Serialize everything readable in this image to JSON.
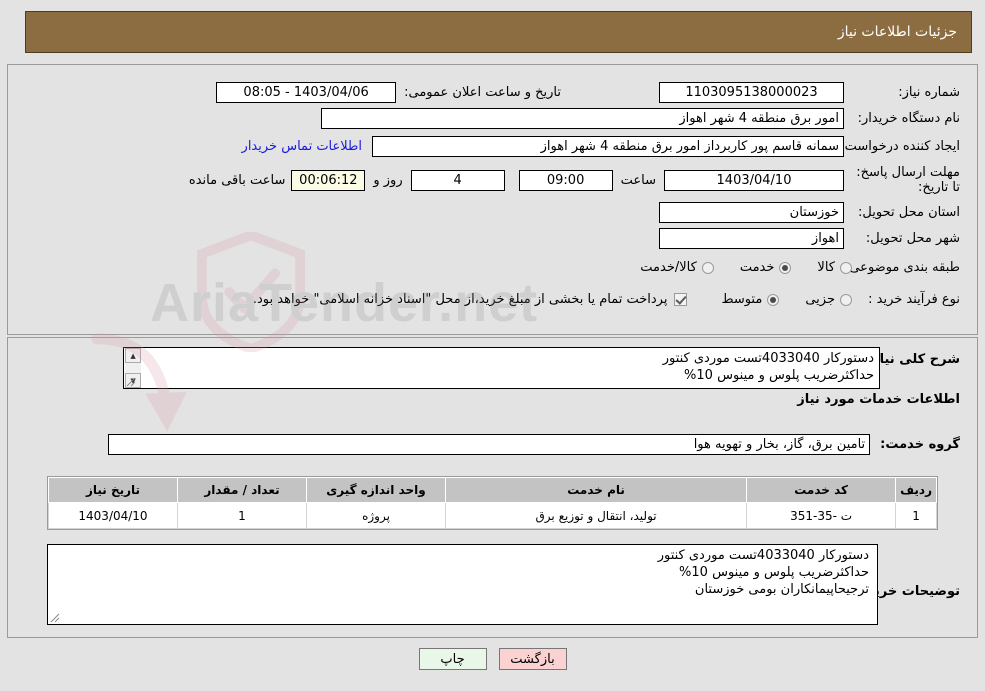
{
  "header": {
    "title": "جزئیات اطلاعات نیاز"
  },
  "top_form": {
    "need_number_label": "شماره نیاز:",
    "need_number_value": "1103095138000023",
    "public_announce_label": "تاریخ و ساعت اعلان عمومی:",
    "public_announce_value": "1403/04/06 - 08:05",
    "buyer_org_label": "نام دستگاه خریدار:",
    "buyer_org_value": "امور برق منطقه 4 شهر اهواز",
    "requester_label": "ایجاد کننده درخواست:",
    "requester_value": "سمانه قاسم پور کاربرداز امور برق منطقه 4 شهر اهواز",
    "buyer_contact_link": "اطلاعات تماس خریدار",
    "deadline_label": "مهلت ارسال پاسخ: تا تاریخ:",
    "deadline_date": "1403/04/10",
    "hour_label": "ساعت",
    "deadline_time": "09:00",
    "days_remaining": "4",
    "days_label": "روز و",
    "countdown": "00:06:12",
    "countdown_suffix": "ساعت باقی مانده",
    "province_label": "استان محل تحویل:",
    "province_value": "خوزستان",
    "city_label": "شهر محل تحویل:",
    "city_value": "اهواز",
    "category_label": "طبقه بندی موضوعی:",
    "category_options": [
      {
        "label": "کالا",
        "selected": false
      },
      {
        "label": "خدمت",
        "selected": true
      },
      {
        "label": "کالا/خدمت",
        "selected": false
      }
    ],
    "process_label": "نوع فرآیند خرید :",
    "process_options": [
      {
        "label": "جزیی",
        "selected": false
      },
      {
        "label": "متوسط",
        "selected": true
      }
    ],
    "treasury_checkbox_checked": true,
    "treasury_note": "پرداخت تمام یا بخشی از مبلغ خرید،از محل \"اسناد خزانه اسلامی\" خواهد بود."
  },
  "need_summary": {
    "label": "شرح کلی نیاز:",
    "value": "دستورکار 4033040تست موردی کنتور\nحداکثرضریب پلوس و مینوس 10%"
  },
  "services_section": {
    "heading": "اطلاعات خدمات مورد نیاز",
    "group_label": "گروه خدمت:",
    "group_value": "تامین برق، گاز، بخار و تهویه هوا"
  },
  "table": {
    "columns": [
      "ردیف",
      "کد خدمت",
      "نام خدمت",
      "واحد اندازه گیری",
      "تعداد / مقدار",
      "تاریخ نیاز"
    ],
    "rows": [
      {
        "radif": "1",
        "code": "ت -35-351",
        "name": "تولید، انتقال و توزیع برق",
        "unit": "پروژه",
        "qty": "1",
        "date": "1403/04/10"
      }
    ]
  },
  "buyer_notes": {
    "label": "توضیحات خریدار:",
    "value": "دستورکار 4033040تست موردی کنتور\nحداکثرضریب پلوس و مینوس 10%\nترجیحاپیمانکاران بومی خوزستان"
  },
  "buttons": {
    "print": "چاپ",
    "back": "بازگشت"
  },
  "watermark": {
    "text": "AriaTender.net"
  },
  "colors": {
    "header_brown": "#8c6d41",
    "panel_bg": "#e3e3e3",
    "table_header": "#c3c3c3",
    "link_blue": "#1a1ae0",
    "btn_print_bg": "#e9f7e9",
    "btn_back_bg": "#fbd2d2",
    "countdown_bg": "#fbfbe6"
  }
}
